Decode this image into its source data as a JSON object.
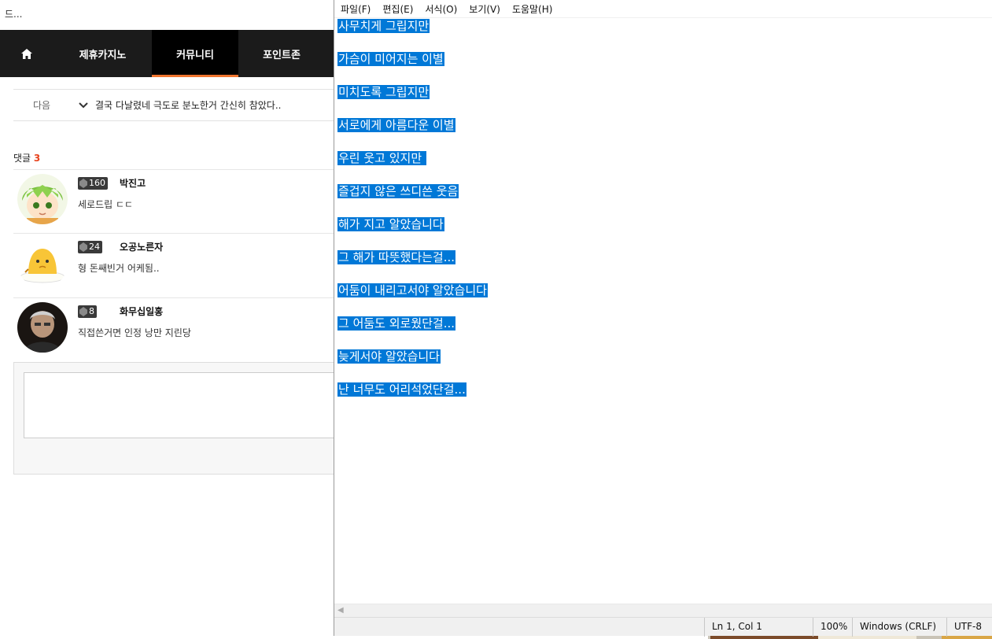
{
  "web": {
    "title": "드...",
    "nav": [
      {
        "label": "",
        "icon": "home-icon"
      },
      {
        "label": "제휴카지노"
      },
      {
        "label": "커뮤니티",
        "active": true
      },
      {
        "label": "포인트존"
      }
    ],
    "next_label": "다음",
    "next_post": "결국 다날렸네 극도로 분노한거 간신히 참았다..",
    "comments_label": "댓글",
    "comments_count": "3",
    "comments": [
      {
        "level": "160",
        "name": "박진고",
        "text": "세로드립 ㄷㄷ",
        "avatar": "green-hair-character-avatar"
      },
      {
        "level": "24",
        "name": "오공노른자",
        "text": "형 돈쌔빈거 어케됨..",
        "avatar": "egg-yolk-avatar"
      },
      {
        "level": "8",
        "name": "화무십일홍",
        "text": "직접쓴거면 인정 낭만 지린당",
        "avatar": "man-photo-avatar"
      }
    ]
  },
  "notepad": {
    "menu": [
      "파일(F)",
      "편집(E)",
      "서식(O)",
      "보기(V)",
      "도움말(H)"
    ],
    "lines": [
      "사무치게 그립지만",
      "가슴이 미어지는 이별",
      "미치도록 그립지만",
      "서로에게 아름다운 이별",
      "우린 웃고 있지만 ",
      "즐겁지 않은 쓰디쓴 웃음",
      "해가 지고 알았습니다",
      "그 해가 따뜻했다는걸...",
      "어둠이 내리고서야 알았습니다",
      "그 어둠도 외로웠단걸...",
      "늦게서야 알았습니다",
      "난 너무도 어리석었단걸..."
    ],
    "status": {
      "position": "Ln 1, Col 1",
      "zoom": "100%",
      "line_ending": "Windows (CRLF)",
      "encoding": "UTF-8"
    },
    "selection_color": "#0078d7"
  }
}
